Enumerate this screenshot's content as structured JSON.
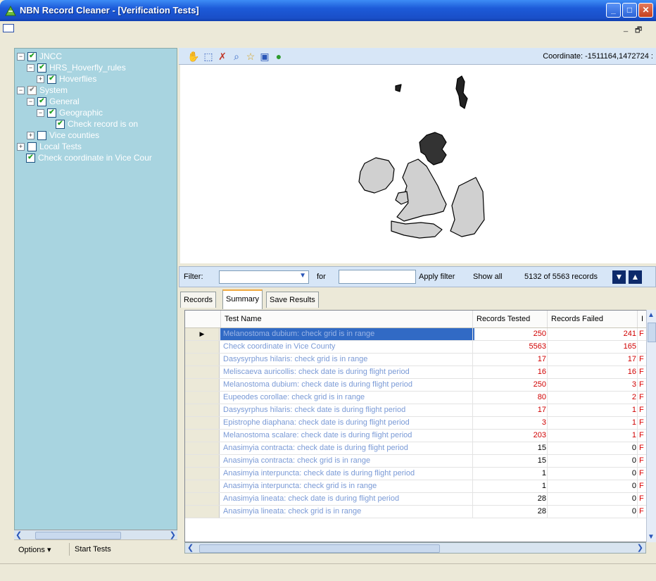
{
  "window": {
    "title": "NBN Record Cleaner - [Verification Tests]"
  },
  "tree": [
    {
      "label": "JNCC",
      "checked": true,
      "expander": "minus",
      "level": 0
    },
    {
      "label": "HRS_Hoverfly_rules",
      "checked": true,
      "expander": "minus",
      "level": 1
    },
    {
      "label": "Hoverflies",
      "checked": true,
      "expander": "plus",
      "level": 2
    },
    {
      "label": "System",
      "checked": "grey",
      "expander": "minus",
      "level": 0
    },
    {
      "label": "General",
      "checked": true,
      "expander": "minus",
      "level": 1
    },
    {
      "label": "Geographic",
      "checked": true,
      "expander": "minus",
      "level": 2
    },
    {
      "label": "Check record is on",
      "checked": true,
      "expander": "none",
      "level": 3
    },
    {
      "label": "Vice counties",
      "checked": false,
      "expander": "plus",
      "level": 1
    },
    {
      "label": "Local Tests",
      "checked": false,
      "expander": "plus",
      "level": 0
    },
    {
      "label": "Check coordinate in Vice Cour",
      "checked": true,
      "expander": "none",
      "level": 0
    }
  ],
  "options_bar": {
    "options_label": "Options ▾",
    "start_label": "Start Tests"
  },
  "map": {
    "coordinate_label": "Coordinate: -1511164,1472724 :"
  },
  "filter": {
    "label": "Filter:",
    "for_label": "for",
    "apply_label": "Apply filter",
    "show_all_label": "Show all",
    "record_count": "5132 of 5563 records"
  },
  "tabs": [
    "Records",
    "Summary",
    "Save Results"
  ],
  "active_tab": "Summary",
  "grid": {
    "columns": [
      "Test Name",
      "Records Tested",
      "Records Failed",
      "I"
    ],
    "rows": [
      {
        "name": "Melanostoma dubium: check grid is in range",
        "tested": "250",
        "failed": "241",
        "extra": "F",
        "tested_red": true,
        "failed_red": true
      },
      {
        "name": "Check coordinate in Vice County",
        "tested": "5563",
        "failed": "165",
        "extra": "",
        "tested_red": true,
        "failed_red": true
      },
      {
        "name": "Dasysyrphus hilaris: check grid is in range",
        "tested": "17",
        "failed": "17",
        "extra": "F",
        "tested_red": true,
        "failed_red": true
      },
      {
        "name": "Meliscaeva auricollis: check date is during flight period",
        "tested": "16",
        "failed": "16",
        "extra": "F",
        "tested_red": true,
        "failed_red": true
      },
      {
        "name": "Melanostoma dubium: check date is during flight period",
        "tested": "250",
        "failed": "3",
        "extra": "F",
        "tested_red": true,
        "failed_red": true
      },
      {
        "name": "Eupeodes corollae: check grid is in range",
        "tested": "80",
        "failed": "2",
        "extra": "F",
        "tested_red": true,
        "failed_red": true
      },
      {
        "name": "Dasysyrphus hilaris: check date is during flight period",
        "tested": "17",
        "failed": "1",
        "extra": "F",
        "tested_red": true,
        "failed_red": true
      },
      {
        "name": "Epistrophe diaphana: check date is during flight period",
        "tested": "3",
        "failed": "1",
        "extra": "F",
        "tested_red": true,
        "failed_red": true
      },
      {
        "name": "Melanostoma scalare: check date is during flight period",
        "tested": "203",
        "failed": "1",
        "extra": "F",
        "tested_red": true,
        "failed_red": true
      },
      {
        "name": "Anasimyia contracta: check date is during flight period",
        "tested": "15",
        "failed": "0",
        "extra": "F",
        "tested_red": false,
        "failed_red": false
      },
      {
        "name": "Anasimyia contracta: check grid is in range",
        "tested": "15",
        "failed": "0",
        "extra": "F",
        "tested_red": false,
        "failed_red": false
      },
      {
        "name": "Anasimyia interpuncta: check date is during flight period",
        "tested": "1",
        "failed": "0",
        "extra": "F",
        "tested_red": false,
        "failed_red": false
      },
      {
        "name": "Anasimyia interpuncta: check grid is in range",
        "tested": "1",
        "failed": "0",
        "extra": "F",
        "tested_red": false,
        "failed_red": false
      },
      {
        "name": "Anasimyia lineata: check date is during flight period",
        "tested": "28",
        "failed": "0",
        "extra": "F",
        "tested_red": false,
        "failed_red": false
      },
      {
        "name": "Anasimyia lineata: check grid is in range",
        "tested": "28",
        "failed": "0",
        "extra": "F",
        "tested_red": false,
        "failed_red": false
      }
    ]
  },
  "colors": {
    "titlebar": "#1c5ad8",
    "tree_bg": "#a8d4e0",
    "selected_row": "#316ac5",
    "failed_text": "#d00000",
    "test_name_text": "#7a9ad6"
  }
}
